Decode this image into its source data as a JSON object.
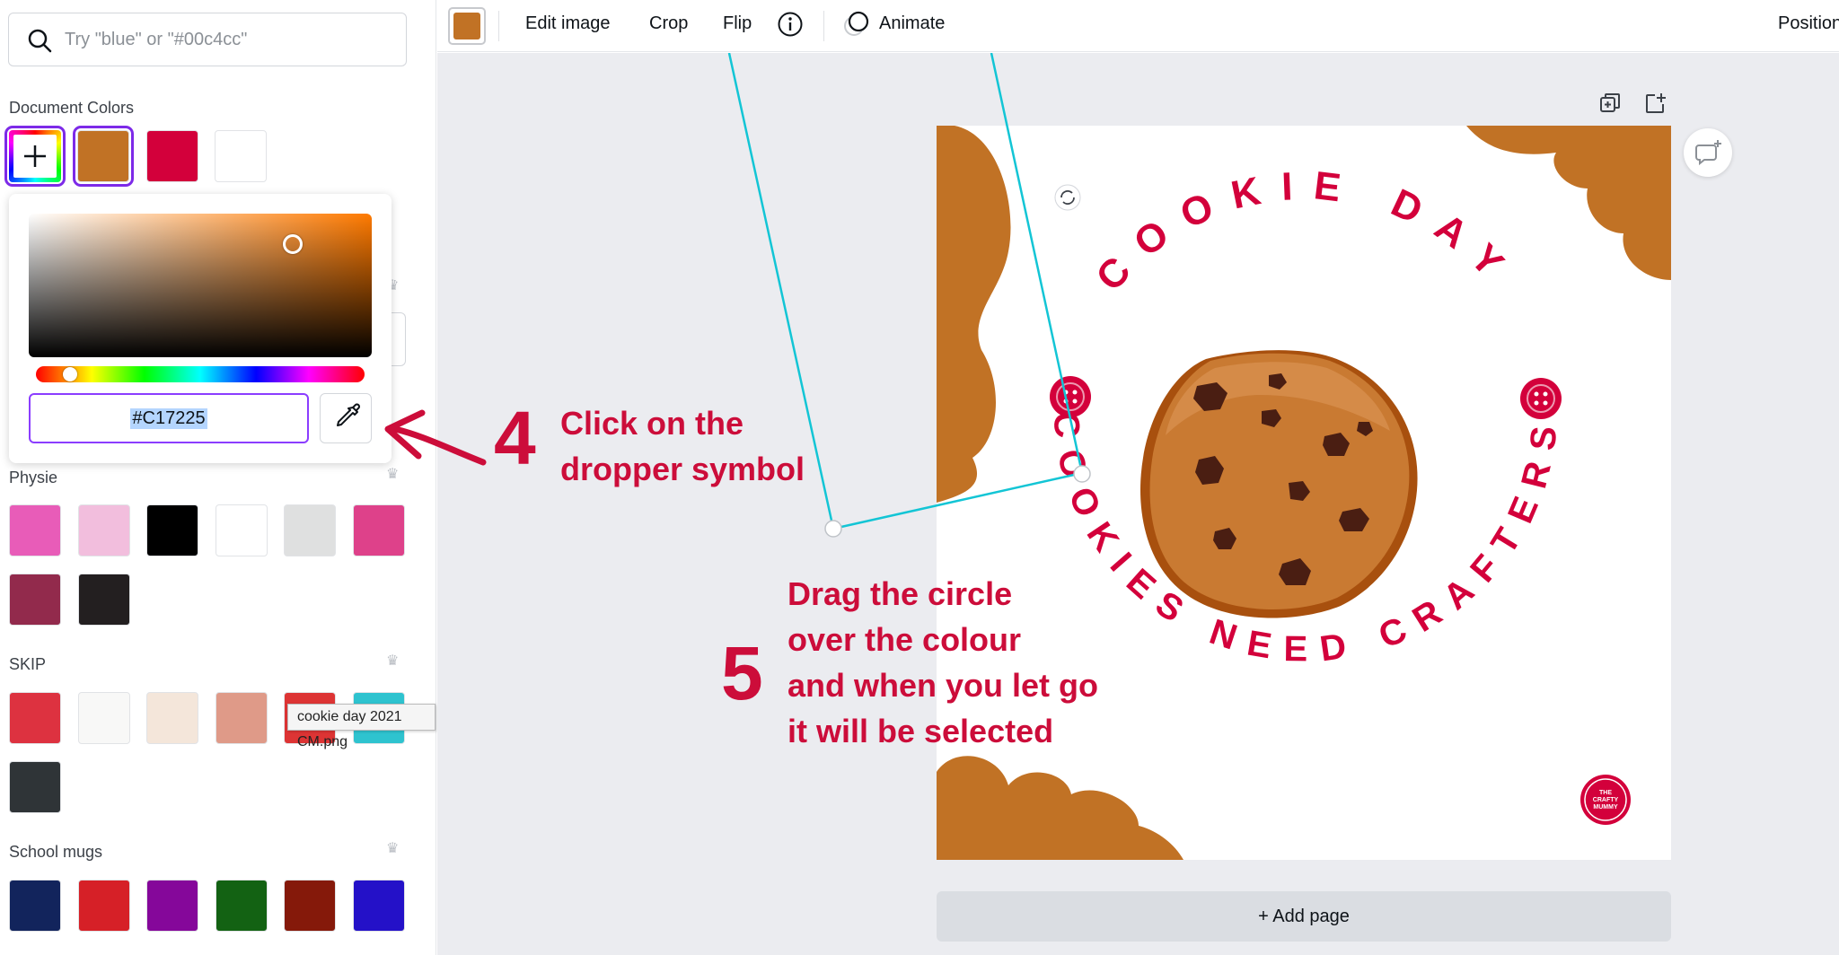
{
  "search": {
    "placeholder": "Try \"blue\" or \"#00c4cc\""
  },
  "document_colors": {
    "title": "Document Colors",
    "swatches": [
      "#C17225",
      "#D3003B",
      "#FFFFFF"
    ]
  },
  "picker": {
    "hex_value": "#C17225"
  },
  "palettes": [
    {
      "name": "Physie",
      "colors": [
        "#E85CB8",
        "#F2BEDD",
        "#000000",
        "#FFFFFF",
        "#DFE0E0",
        "#DE418A",
        "#922A4C",
        "#231F20"
      ]
    },
    {
      "name": "SKIP",
      "colors": [
        "#DD3240",
        "#F8F8F7",
        "#F4E6DA",
        "#DF9A88",
        "#DD3434",
        "#2EC3CF",
        "#2F3437"
      ]
    },
    {
      "name": "School mugs",
      "colors": [
        "#12245C",
        "#D62027",
        "#85079A",
        "#136213",
        "#85190A",
        "#2411C8"
      ]
    }
  ],
  "tooltip": "cookie day 2021 CM.png",
  "toolbar": {
    "color": "#C17225",
    "edit_image": "Edit image",
    "crop": "Crop",
    "flip": "Flip",
    "animate": "Animate",
    "position": "Position"
  },
  "canvas": {
    "add_page": "+ Add page",
    "design": {
      "top_text": "COOKIE DAY",
      "bottom_text": "COOKIES NEED CRAFTERS",
      "logo_text": "THE CRAFTY MUMMY",
      "brand_color": "#C17225",
      "accent_color": "#D3003B"
    }
  },
  "annotations": {
    "step4_number": "4",
    "step4_line1": "Click on the",
    "step4_line2": "dropper symbol",
    "step5_number": "5",
    "step5_line1": "Drag the circle",
    "step5_line2": "over the colour",
    "step5_line3": "and when you let go",
    "step5_line4": "it will be selected"
  }
}
